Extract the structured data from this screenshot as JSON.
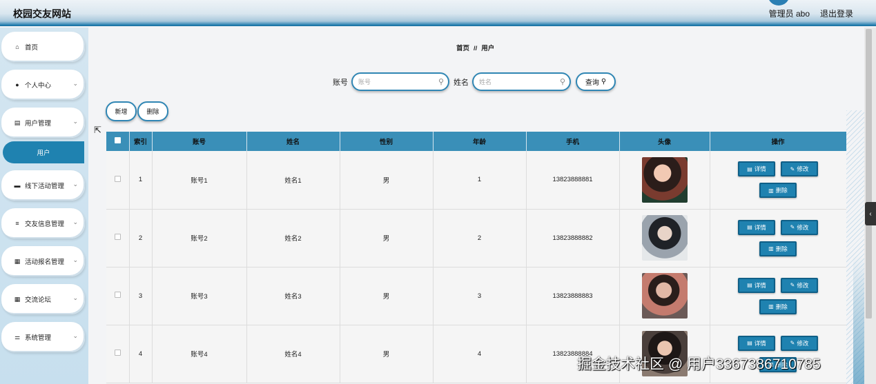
{
  "header": {
    "site_title": "校园交友网站",
    "user_info": "管理员 abo",
    "logout": "退出登录"
  },
  "sidebar": {
    "items": [
      {
        "label": "首页",
        "icon": "home-icon",
        "glyph": "⌂"
      },
      {
        "label": "个人中心",
        "icon": "person-icon",
        "glyph": "●"
      },
      {
        "label": "用户管理",
        "icon": "clipboard-icon",
        "glyph": "▤"
      },
      {
        "label": "线下活动管理",
        "icon": "briefcase-icon",
        "glyph": "▬"
      },
      {
        "label": "交友信息管理",
        "icon": "list-icon",
        "glyph": "≡"
      },
      {
        "label": "活动报名管理",
        "icon": "grid-icon",
        "glyph": "▦"
      },
      {
        "label": "交流论坛",
        "icon": "grid-icon",
        "glyph": "▦"
      },
      {
        "label": "系统管理",
        "icon": "sliders-icon",
        "glyph": "⚌"
      }
    ],
    "active_sub": "用户"
  },
  "breadcrumb": {
    "home": "首页",
    "sep": "//",
    "current": "用户"
  },
  "search": {
    "account_label": "账号",
    "account_placeholder": "账号",
    "name_label": "姓名",
    "name_placeholder": "姓名",
    "query_label": "查询"
  },
  "actions": {
    "add": "新增",
    "delete": "删除"
  },
  "table": {
    "headers": [
      "索引",
      "账号",
      "姓名",
      "性别",
      "年龄",
      "手机",
      "头像",
      "操作"
    ],
    "rows": [
      {
        "index": "1",
        "account": "账号1",
        "name": "姓名1",
        "gender": "男",
        "age": "1",
        "phone": "13823888881"
      },
      {
        "index": "2",
        "account": "账号2",
        "name": "姓名2",
        "gender": "男",
        "age": "2",
        "phone": "13823888882"
      },
      {
        "index": "3",
        "account": "账号3",
        "name": "姓名3",
        "gender": "男",
        "age": "3",
        "phone": "13823888883"
      },
      {
        "index": "4",
        "account": "账号4",
        "name": "姓名4",
        "gender": "男",
        "age": "4",
        "phone": "13823888884"
      }
    ],
    "row_actions": {
      "detail": "详情",
      "edit": "修改",
      "delete": "删除"
    }
  },
  "watermark": "掘金技术社区 @ 用户3367386710785",
  "colors": {
    "accent": "#1f82b0",
    "header_border": "#1f78a8",
    "table_header": "#3a8fb8"
  }
}
